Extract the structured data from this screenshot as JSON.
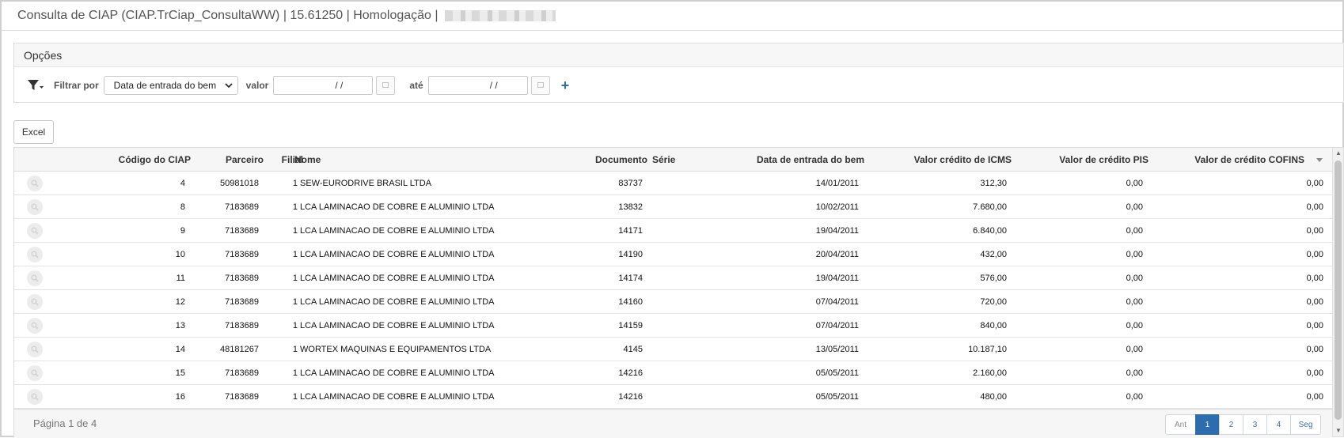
{
  "window": {
    "title": "Consulta de CIAP (CIAP.TrCiap_ConsultaWW) | 15.61250 | Homologação |"
  },
  "options": {
    "header": "Opções",
    "filter_by_label": "Filtrar por",
    "filter_field": "Data de entrada do bem",
    "value_label": "valor",
    "from_value": "/ /",
    "until_label": "até",
    "to_value": "/ /",
    "add_symbol": "+"
  },
  "toolbar": {
    "excel_label": "Excel"
  },
  "table": {
    "columns": {
      "codigo": "Código do CIAP",
      "parceiro": "Parceiro",
      "filial": "Filial",
      "nome": "Nome",
      "documento": "Documento",
      "serie": "Série",
      "data": "Data de entrada do bem",
      "icms": "Valor crédito de ICMS",
      "pis": "Valor de crédito PIS",
      "cofins": "Valor de crédito COFINS"
    },
    "rows": [
      {
        "codigo": "4",
        "parceiro": "50981018",
        "filial": "1",
        "nome": "SEW-EURODRIVE BRASIL LTDA",
        "documento": "83737",
        "serie": "",
        "data": "14/01/2011",
        "icms": "312,30",
        "pis": "0,00",
        "cofins": "0,00"
      },
      {
        "codigo": "8",
        "parceiro": "7183689",
        "filial": "1",
        "nome": "LCA LAMINACAO DE COBRE E ALUMINIO LTDA",
        "documento": "13832",
        "serie": "",
        "data": "10/02/2011",
        "icms": "7.680,00",
        "pis": "0,00",
        "cofins": "0,00"
      },
      {
        "codigo": "9",
        "parceiro": "7183689",
        "filial": "1",
        "nome": "LCA LAMINACAO DE COBRE E ALUMINIO LTDA",
        "documento": "14171",
        "serie": "",
        "data": "19/04/2011",
        "icms": "6.840,00",
        "pis": "0,00",
        "cofins": "0,00"
      },
      {
        "codigo": "10",
        "parceiro": "7183689",
        "filial": "1",
        "nome": "LCA LAMINACAO DE COBRE E ALUMINIO LTDA",
        "documento": "14190",
        "serie": "",
        "data": "20/04/2011",
        "icms": "432,00",
        "pis": "0,00",
        "cofins": "0,00"
      },
      {
        "codigo": "11",
        "parceiro": "7183689",
        "filial": "1",
        "nome": "LCA LAMINACAO DE COBRE E ALUMINIO LTDA",
        "documento": "14174",
        "serie": "",
        "data": "19/04/2011",
        "icms": "576,00",
        "pis": "0,00",
        "cofins": "0,00"
      },
      {
        "codigo": "12",
        "parceiro": "7183689",
        "filial": "1",
        "nome": "LCA LAMINACAO DE COBRE E ALUMINIO LTDA",
        "documento": "14160",
        "serie": "",
        "data": "07/04/2011",
        "icms": "720,00",
        "pis": "0,00",
        "cofins": "0,00"
      },
      {
        "codigo": "13",
        "parceiro": "7183689",
        "filial": "1",
        "nome": "LCA LAMINACAO DE COBRE E ALUMINIO LTDA",
        "documento": "14159",
        "serie": "",
        "data": "07/04/2011",
        "icms": "840,00",
        "pis": "0,00",
        "cofins": "0,00"
      },
      {
        "codigo": "14",
        "parceiro": "48181267",
        "filial": "1",
        "nome": "WORTEX MAQUINAS E EQUIPAMENTOS LTDA",
        "documento": "4145",
        "serie": "",
        "data": "13/05/2011",
        "icms": "10.187,10",
        "pis": "0,00",
        "cofins": "0,00"
      },
      {
        "codigo": "15",
        "parceiro": "7183689",
        "filial": "1",
        "nome": "LCA LAMINACAO DE COBRE E ALUMINIO LTDA",
        "documento": "14216",
        "serie": "",
        "data": "05/05/2011",
        "icms": "2.160,00",
        "pis": "0,00",
        "cofins": "0,00"
      },
      {
        "codigo": "16",
        "parceiro": "7183689",
        "filial": "1",
        "nome": "LCA LAMINACAO DE COBRE E ALUMINIO LTDA",
        "documento": "14216",
        "serie": "",
        "data": "05/05/2011",
        "icms": "480,00",
        "pis": "0,00",
        "cofins": "0,00"
      }
    ]
  },
  "pagination": {
    "info": "Página 1 de 4",
    "prev": "Ant",
    "pages": [
      "1",
      "2",
      "3",
      "4"
    ],
    "next": "Seg"
  },
  "colors": {
    "accent": "#2d6cad",
    "plus": "#2a6ebb"
  }
}
